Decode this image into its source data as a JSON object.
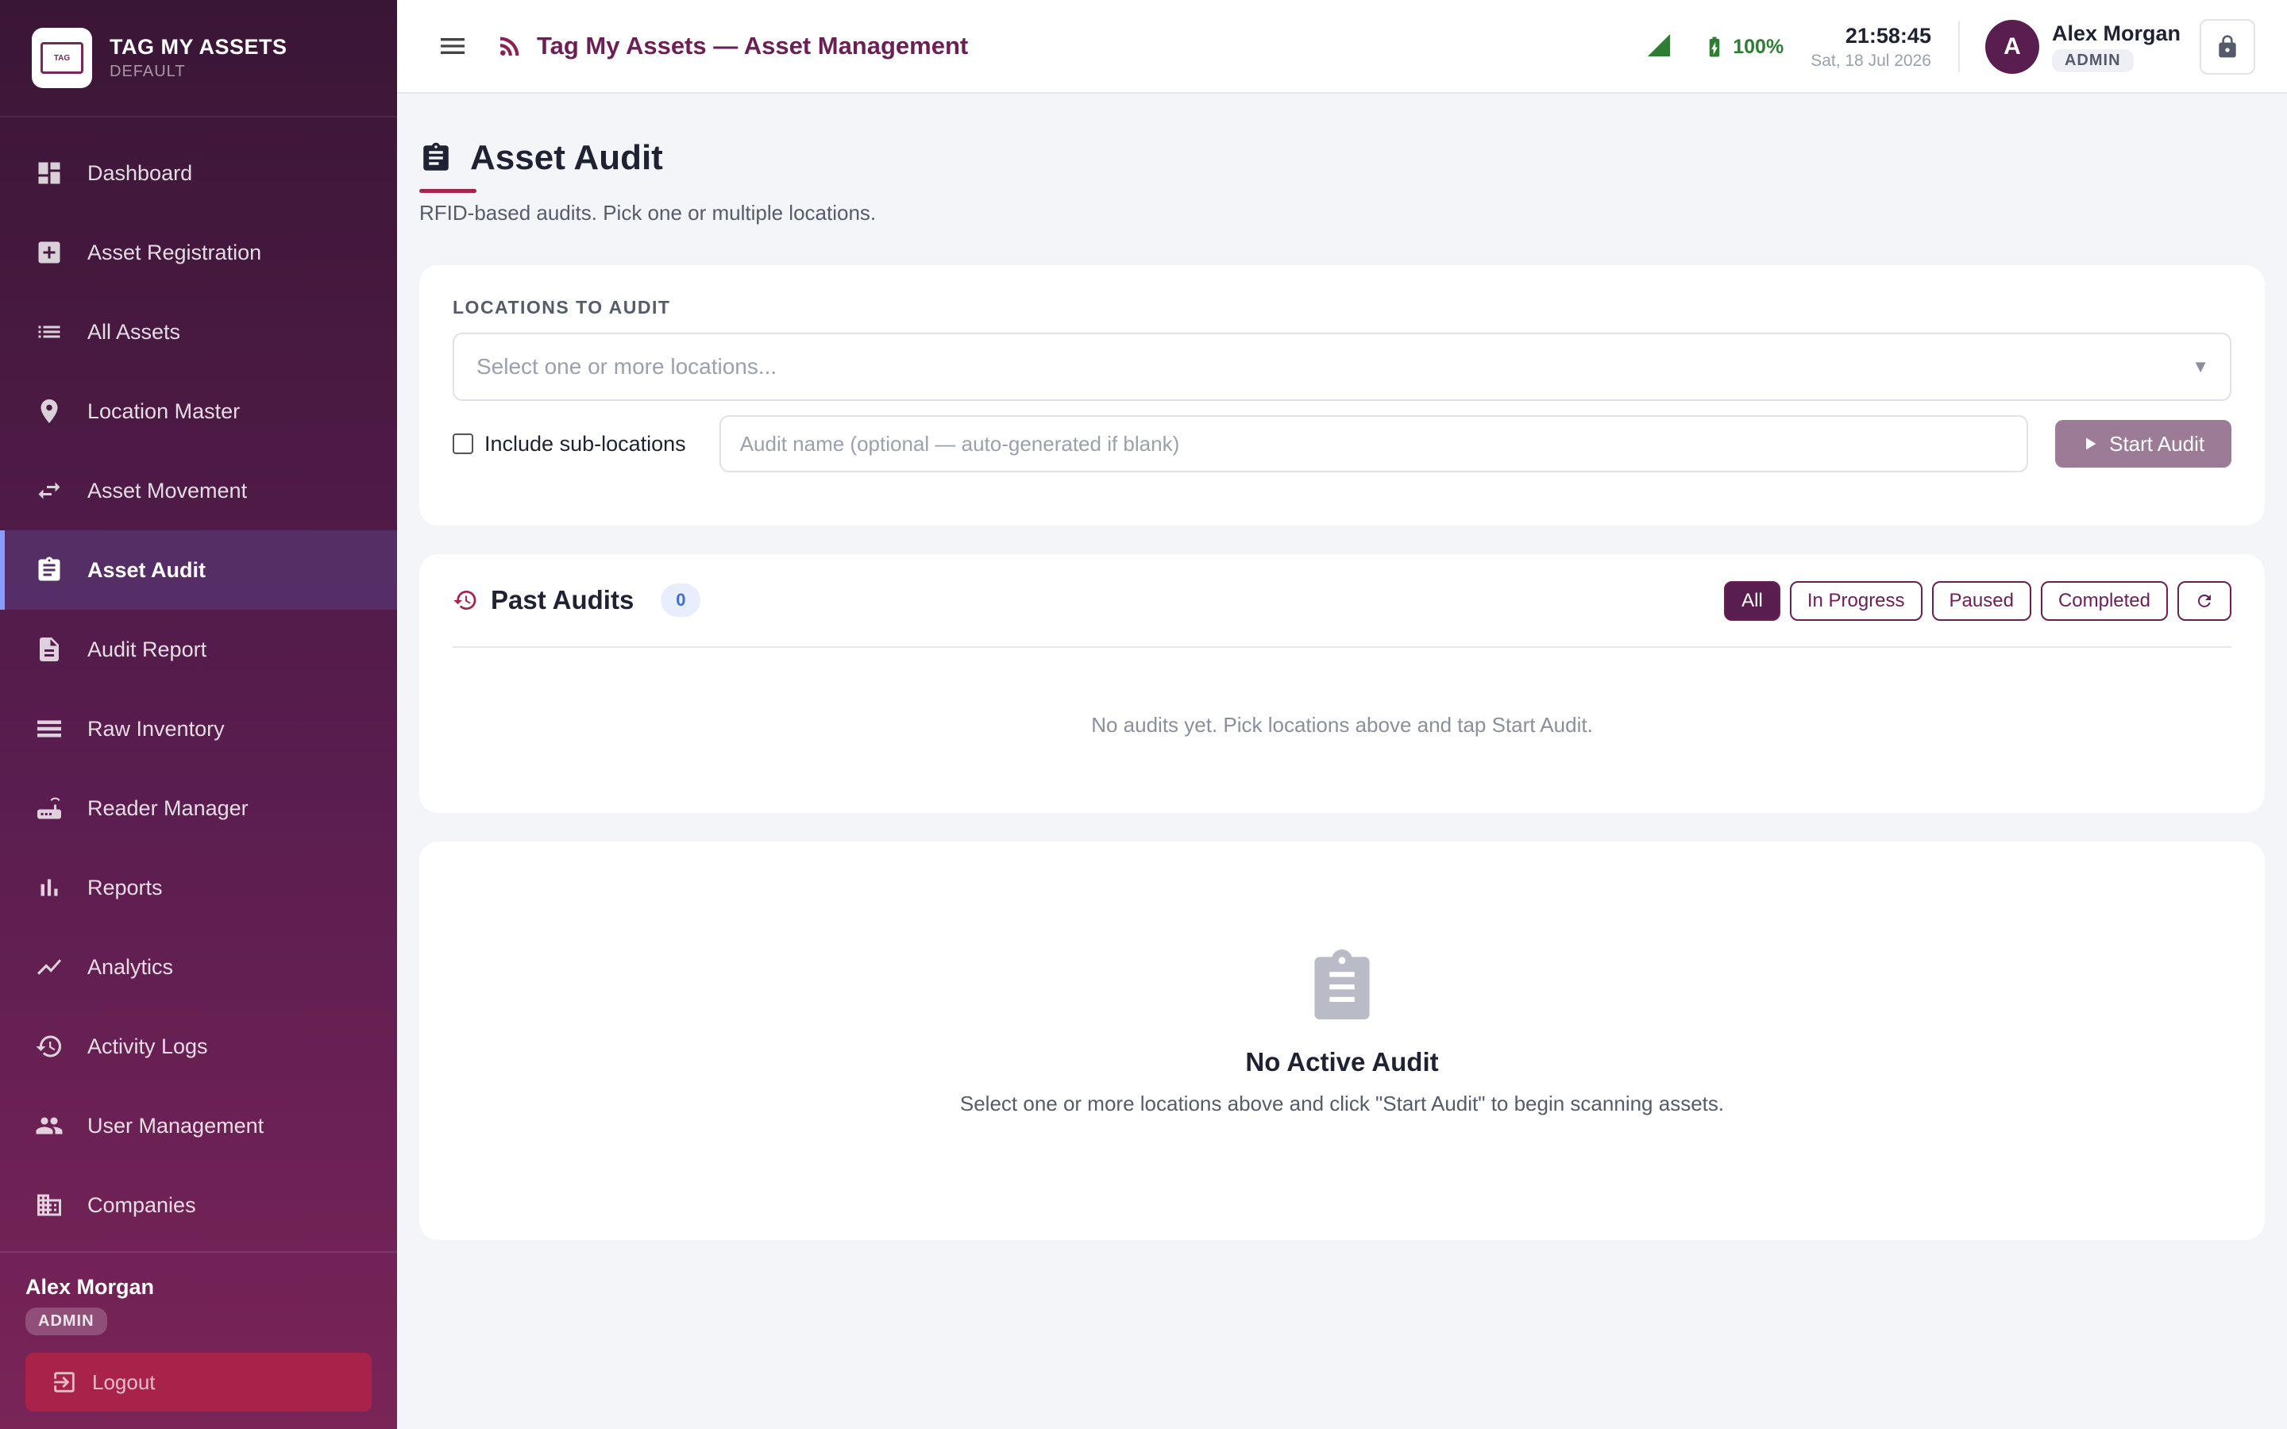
{
  "brand": {
    "title": "TAG MY ASSETS",
    "subtitle": "DEFAULT",
    "logo_text": "TAG MY ASSETS"
  },
  "sidebar": {
    "items": [
      {
        "label": "Dashboard",
        "icon": "dashboard-icon"
      },
      {
        "label": "Asset Registration",
        "icon": "add-box-icon"
      },
      {
        "label": "All Assets",
        "icon": "list-icon"
      },
      {
        "label": "Location Master",
        "icon": "location-pin-icon"
      },
      {
        "label": "Asset Movement",
        "icon": "swap-arrows-icon"
      },
      {
        "label": "Asset Audit",
        "icon": "clipboard-icon",
        "active": true
      },
      {
        "label": "Audit Report",
        "icon": "document-icon"
      },
      {
        "label": "Raw Inventory",
        "icon": "rows-icon"
      },
      {
        "label": "Reader Manager",
        "icon": "router-icon"
      },
      {
        "label": "Reports",
        "icon": "bar-chart-icon"
      },
      {
        "label": "Analytics",
        "icon": "trend-icon"
      },
      {
        "label": "Activity Logs",
        "icon": "history-icon"
      },
      {
        "label": "User Management",
        "icon": "people-icon"
      },
      {
        "label": "Companies",
        "icon": "building-icon"
      }
    ],
    "footer": {
      "user": "Alex Morgan",
      "role": "ADMIN",
      "logout": "Logout"
    }
  },
  "header": {
    "title": "Tag My Assets — Asset Management",
    "battery": "100%",
    "time": "21:58:45",
    "date": "Sat, 18 Jul 2026",
    "user_initial": "A",
    "user_name": "Alex Morgan",
    "user_role": "ADMIN"
  },
  "page": {
    "title": "Asset Audit",
    "subtitle": "RFID-based audits. Pick one or multiple locations."
  },
  "audit_form": {
    "locations_label": "LOCATIONS TO AUDIT",
    "locations_placeholder": "Select one or more locations...",
    "caret": "▼",
    "include_sub_label": "Include sub-locations",
    "audit_name_placeholder": "Audit name (optional — auto-generated if blank)",
    "start_label": "Start Audit"
  },
  "past_audits": {
    "title": "Past Audits",
    "count": "0",
    "filters": [
      "All",
      "In Progress",
      "Paused",
      "Completed"
    ],
    "active_filter": "All",
    "empty_message": "No audits yet. Pick locations above and tap Start Audit."
  },
  "active_audit": {
    "title": "No Active Audit",
    "message": "Select one or more locations above and click \"Start Audit\" to begin scanning assets."
  },
  "colors": {
    "brand": "#6b1f55",
    "accent": "#a8224a",
    "battery": "#2e7d32"
  }
}
